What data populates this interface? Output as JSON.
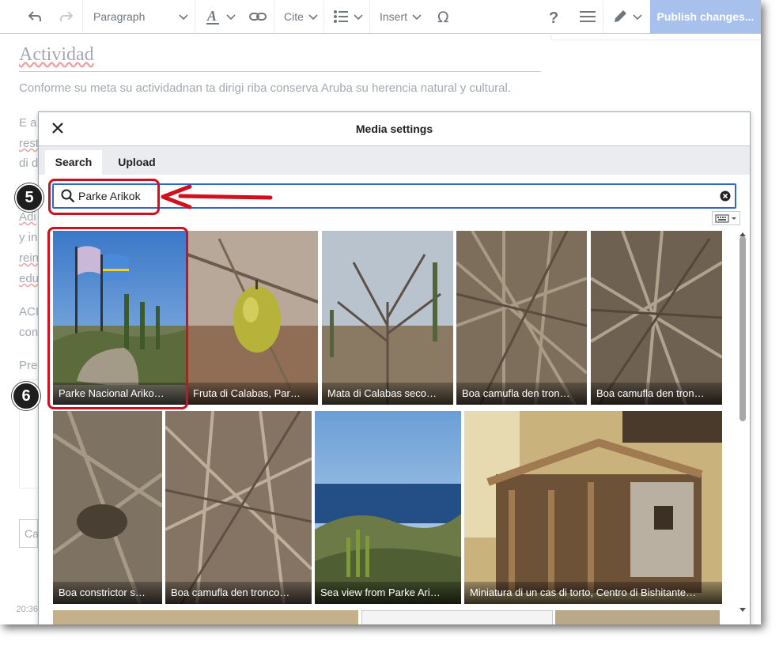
{
  "toolbar": {
    "paragraph_label": "Paragraph",
    "cite_label": "Cite",
    "insert_label": "Insert",
    "publish_label": "Publish changes..."
  },
  "article": {
    "heading": "Actividad",
    "intro": "Conforme su meta su actividadnan ta dirigi riba conserva Aruba su herencia natural y cultural.",
    "fragments": [
      "E a",
      "rest",
      "di d",
      "Adi",
      "y in",
      "rein",
      "edu",
      "ACI",
      "con",
      "Pre"
    ],
    "category_fragment": "Ca",
    "timestamp": "20:36"
  },
  "dialog": {
    "title": "Media settings",
    "tabs": [
      {
        "label": "Search"
      },
      {
        "label": "Upload"
      }
    ],
    "search": {
      "value": "Parke Arikok"
    },
    "results": [
      {
        "caption": "Parke Nacional Ariko…"
      },
      {
        "caption": "Fruta di Calabas, Par…"
      },
      {
        "caption": "Mata di Calabas seco…"
      },
      {
        "caption": "Boa camufla den tron…"
      },
      {
        "caption": "Boa camufla den tron…"
      },
      {
        "caption": "Boa constrictor s…"
      },
      {
        "caption": "Boa camufla den tronco…"
      },
      {
        "caption": "Sea view from Parke Ari…"
      },
      {
        "caption": "Miniatura di un cas di torto, Centro di Bishitante…"
      }
    ]
  },
  "annotations": {
    "step_search": "5",
    "step_result": "6",
    "accent": "#d0101c"
  }
}
